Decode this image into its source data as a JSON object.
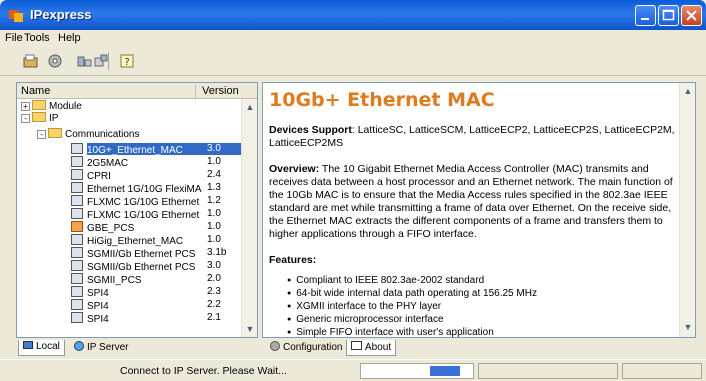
{
  "window": {
    "title": "IPexpress"
  },
  "menu": [
    "File",
    "Tools",
    "Help"
  ],
  "toolbar": {
    "icons": [
      "open-icon",
      "settings-icon",
      "module-icon",
      "generate-icon",
      "help-icon"
    ]
  },
  "tree": {
    "header": {
      "name": "Name",
      "version": "Version"
    },
    "items": [
      {
        "label": "Module",
        "version": "",
        "type": "folder",
        "expander": "+"
      },
      {
        "label": "IP",
        "version": "",
        "type": "folder",
        "expander": "-"
      },
      {
        "label": "Communications",
        "version": "",
        "type": "folder",
        "expander": "-"
      },
      {
        "label": "10G+_Ethernet_MAC",
        "version": "3.0",
        "type": "core",
        "selected": true
      },
      {
        "label": "2G5MAC",
        "version": "1.0",
        "type": "core"
      },
      {
        "label": "CPRI",
        "version": "2.4",
        "type": "core"
      },
      {
        "label": "Ethernet 1G/10G FlexiMA",
        "version": "1.3",
        "type": "core"
      },
      {
        "label": "FLXMC 1G/10G Ethernet",
        "version": "1.2",
        "type": "core"
      },
      {
        "label": "FLXMC 1G/10G Ethernet",
        "version": "1.0",
        "type": "core"
      },
      {
        "label": "GBE_PCS",
        "version": "1.0",
        "type": "core-alert"
      },
      {
        "label": "HiGig_Ethernet_MAC",
        "version": "1.0",
        "type": "core"
      },
      {
        "label": "SGMII/Gb Ethernet PCS",
        "version": "3.1b",
        "type": "core"
      },
      {
        "label": "SGMII/Gb Ethernet PCS",
        "version": "3.0",
        "type": "core"
      },
      {
        "label": "SGMII_PCS",
        "version": "2.0",
        "type": "core"
      },
      {
        "label": "SPI4",
        "version": "2.3",
        "type": "core"
      },
      {
        "label": "SPI4",
        "version": "2.2",
        "type": "core"
      },
      {
        "label": "SPI4",
        "version": "2.1",
        "type": "core"
      }
    ]
  },
  "left_tabs": {
    "local": "Local",
    "ip_server": "IP Server",
    "active": "Local"
  },
  "content": {
    "title": "10Gb+ Ethernet MAC",
    "devices_label": "Devices Support",
    "devices_text": ": LatticeSC, LatticeSCM, LatticeECP2, LatticeECP2S, LatticeECP2M, LatticeECP2MS",
    "overview_label": "Overview:",
    "overview_text": " The 10 Gigabit Ethernet Media Access Controller (MAC) transmits and receives data between a host processor and an Ethernet network. The main function of the 10Gb MAC is to ensure that the Media Access rules specified in the 802.3ae IEEE standard are met while transmitting a frame of data over Ethernet. On the receive side, the Ethernet MAC extracts the different components of a frame and transfers them to higher applications through a FIFO interface.",
    "features_label": "Features:",
    "features": [
      "Compliant to IEEE 802.3ae-2002 standard",
      "64-bit wide internal data path operating at 156.25 MHz",
      "XGMII interface to the PHY layer",
      "Generic microprocessor interface",
      "Simple FIFO interface with user's application"
    ]
  },
  "right_tabs": {
    "configuration": "Configuration",
    "about": "About",
    "active": "About"
  },
  "status": {
    "message": "Connect to IP Server. Please Wait...",
    "progress_fraction": 0.27
  },
  "colors": {
    "title_orange": "#e07a1f",
    "selection": "#316ac5",
    "titlebar": "#0a5bd7"
  }
}
